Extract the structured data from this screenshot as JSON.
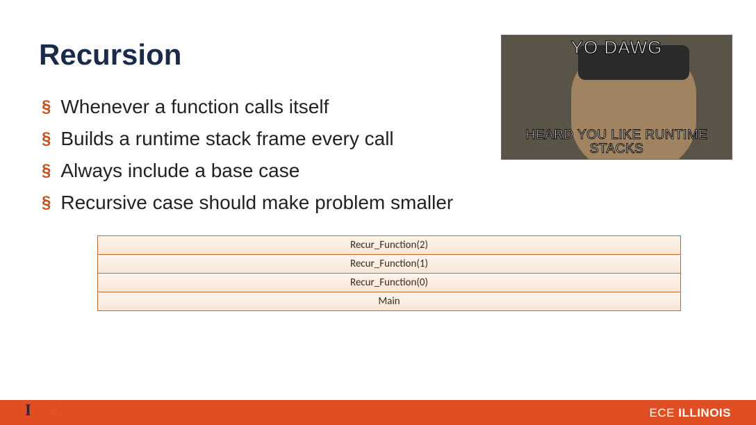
{
  "title": "Recursion",
  "bullets": [
    "Whenever a function calls itself",
    "Builds a runtime stack frame every call",
    "Always include a base case",
    "Recursive case should make problem smaller"
  ],
  "meme": {
    "top": "YO DAWG",
    "bottom": "HEARD YOU LIKE RUNTIME STACKS"
  },
  "stack": [
    "Recur_Function(2)",
    "Recur_Function(1)",
    "Recur_Function(0)",
    "Main"
  ],
  "footer": {
    "logo_letter": "I",
    "page_number": "22",
    "right_ece": "ECE ",
    "right_illinois": "ILLINOIS"
  }
}
